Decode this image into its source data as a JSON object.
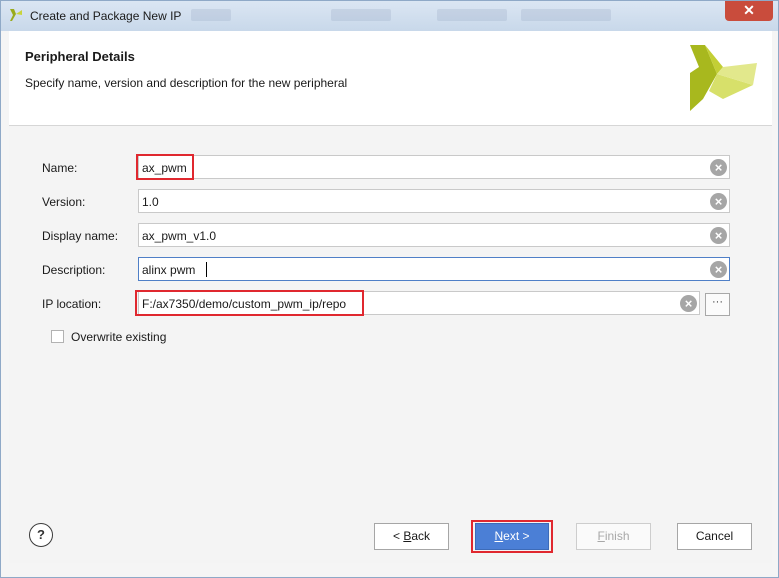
{
  "window": {
    "title": "Create and Package New IP",
    "close_symbol": "✕"
  },
  "header": {
    "title": "Peripheral Details",
    "subtitle": "Specify name, version and description for the new peripheral"
  },
  "form": {
    "name": {
      "label": "Name:",
      "value": "ax_pwm"
    },
    "version": {
      "label": "Version:",
      "value": "1.0"
    },
    "display_name": {
      "label": "Display name:",
      "value": "ax_pwm_v1.0"
    },
    "description": {
      "label": "Description:",
      "value": "alinx pwm"
    },
    "ip_location": {
      "label": "IP location:",
      "value": "F:/ax7350/demo/custom_pwm_ip/repo",
      "browse_label": "···"
    },
    "overwrite": {
      "label": "Overwrite existing",
      "checked": false
    }
  },
  "footer": {
    "help_label": "?",
    "back_prefix": "< ",
    "back_mnemonic": "B",
    "back_rest": "ack",
    "next_mnemonic": "N",
    "next_rest": "ext >",
    "finish_mnemonic": "F",
    "finish_rest": "inish",
    "cancel_label": "Cancel"
  },
  "colors": {
    "highlight": "#e0282f",
    "primary": "#4b7fd6",
    "logo_green": "#a8b81e"
  }
}
